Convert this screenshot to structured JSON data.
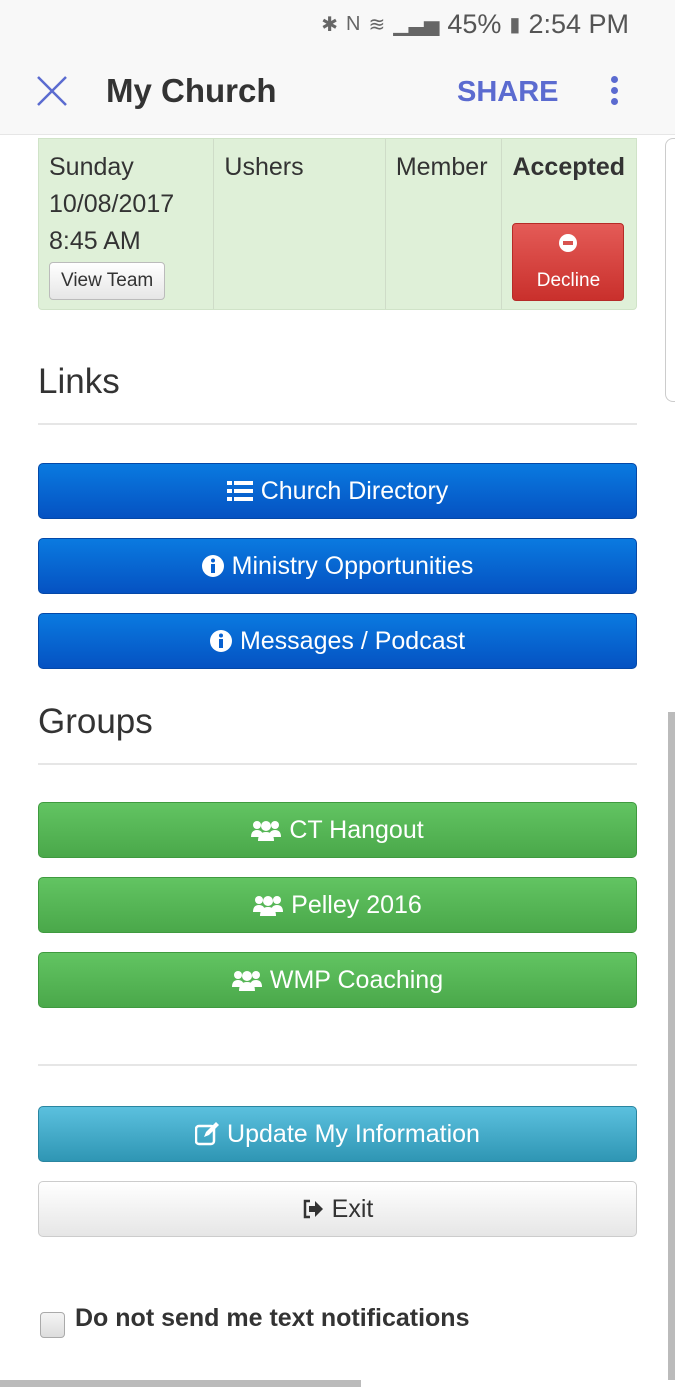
{
  "status_bar": {
    "battery": "45%",
    "time": "2:54 PM",
    "icons": [
      "bluetooth-icon",
      "nfc-icon",
      "wifi-icon",
      "4g-icon",
      "signal-icon",
      "battery-icon"
    ]
  },
  "toolbar": {
    "title": "My Church",
    "share": "SHARE",
    "accent": "#5b6bd0"
  },
  "schedule": {
    "day": "Sunday",
    "date": "10/08/2017",
    "time": "8:45 AM",
    "view_team": "View Team",
    "team": "Ushers",
    "role": "Member",
    "status": "Accepted",
    "decline": "Decline"
  },
  "links": {
    "heading": "Links",
    "items": [
      {
        "label": "Church Directory",
        "icon": "list-icon"
      },
      {
        "label": "Ministry Opportunities",
        "icon": "info-icon"
      },
      {
        "label": "Messages / Podcast",
        "icon": "info-icon"
      }
    ]
  },
  "groups": {
    "heading": "Groups",
    "items": [
      {
        "label": "CT Hangout",
        "icon": "users-icon"
      },
      {
        "label": "Pelley 2016",
        "icon": "users-icon"
      },
      {
        "label": "WMP Coaching",
        "icon": "users-icon"
      }
    ]
  },
  "actions": {
    "update": "Update My Information",
    "exit": "Exit"
  },
  "notifications": {
    "label": "Do not send me text notifications",
    "checked": false
  }
}
